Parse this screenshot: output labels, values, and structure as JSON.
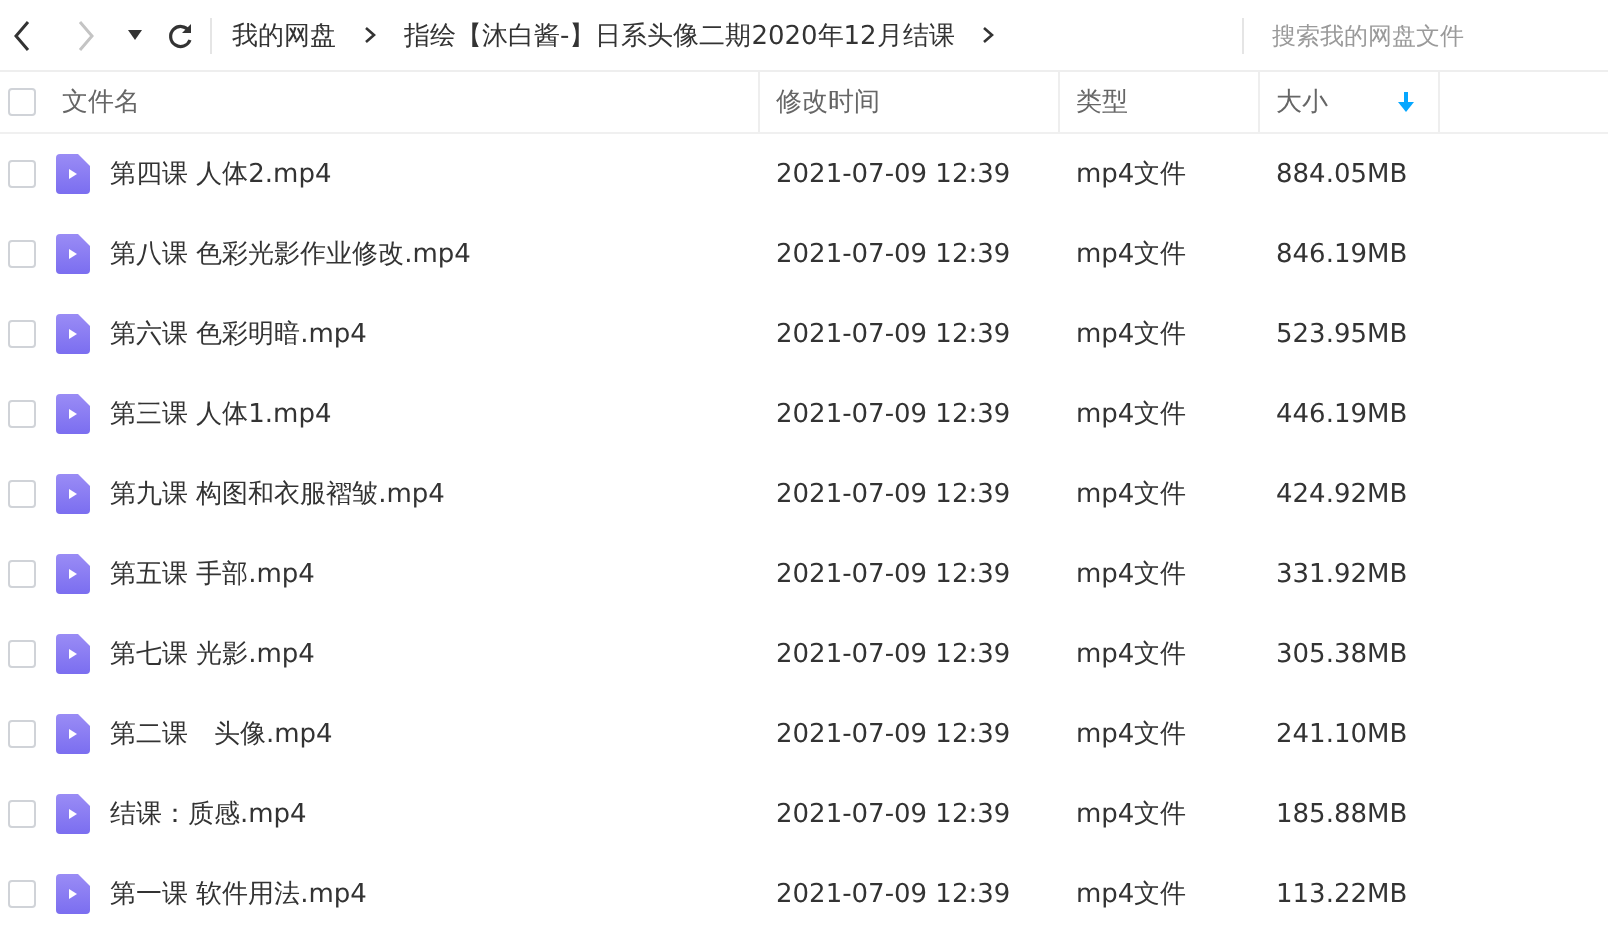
{
  "toolbar": {
    "breadcrumbs": [
      {
        "label": "我的网盘"
      },
      {
        "label": "指绘【沐白酱-】日系头像二期2020年12月结课"
      }
    ],
    "search": {
      "placeholder": "搜索我的网盘文件"
    }
  },
  "table": {
    "select_all": {
      "checked": false
    },
    "columns": [
      {
        "label": "文件名",
        "sorted": false
      },
      {
        "label": "修改时间",
        "sorted": false
      },
      {
        "label": "类型",
        "sorted": false
      },
      {
        "label": "大小",
        "sorted": true
      }
    ],
    "rows": [
      {
        "checked": false,
        "kind": "video",
        "name": "第四课 人体2.mp4",
        "modified": "2021-07-09 12:39",
        "type": "mp4文件",
        "size": "884.05MB"
      },
      {
        "checked": false,
        "kind": "video",
        "name": "第八课 色彩光影作业修改.mp4",
        "modified": "2021-07-09 12:39",
        "type": "mp4文件",
        "size": "846.19MB"
      },
      {
        "checked": false,
        "kind": "video",
        "name": "第六课 色彩明暗.mp4",
        "modified": "2021-07-09 12:39",
        "type": "mp4文件",
        "size": "523.95MB"
      },
      {
        "checked": false,
        "kind": "video",
        "name": "第三课 人体1.mp4",
        "modified": "2021-07-09 12:39",
        "type": "mp4文件",
        "size": "446.19MB"
      },
      {
        "checked": false,
        "kind": "video",
        "name": "第九课 构图和衣服褶皱.mp4",
        "modified": "2021-07-09 12:39",
        "type": "mp4文件",
        "size": "424.92MB"
      },
      {
        "checked": false,
        "kind": "video",
        "name": "第五课 手部.mp4",
        "modified": "2021-07-09 12:39",
        "type": "mp4文件",
        "size": "331.92MB"
      },
      {
        "checked": false,
        "kind": "video",
        "name": "第七课 光影.mp4",
        "modified": "2021-07-09 12:39",
        "type": "mp4文件",
        "size": "305.38MB"
      },
      {
        "checked": false,
        "kind": "video",
        "name": "第二课　头像.mp4",
        "modified": "2021-07-09 12:39",
        "type": "mp4文件",
        "size": "241.10MB"
      },
      {
        "checked": false,
        "kind": "video",
        "name": "结课：质感.mp4",
        "modified": "2021-07-09 12:39",
        "type": "mp4文件",
        "size": "185.88MB"
      },
      {
        "checked": false,
        "kind": "video",
        "name": "第一课 软件用法.mp4",
        "modified": "2021-07-09 12:39",
        "type": "mp4文件",
        "size": "113.22MB"
      }
    ]
  }
}
